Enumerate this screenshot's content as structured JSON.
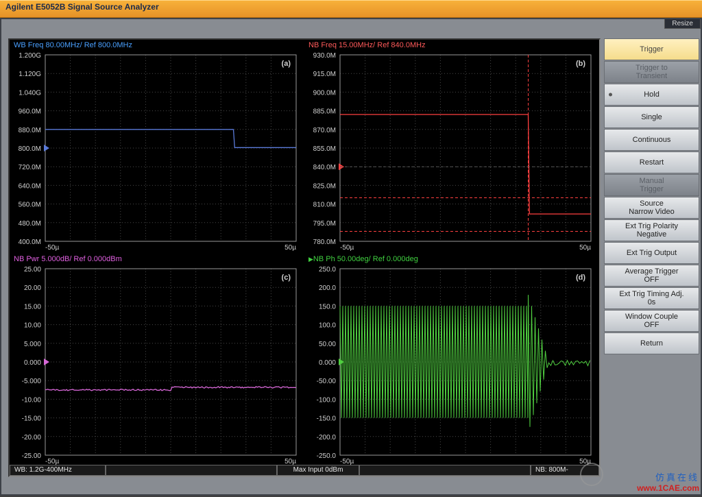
{
  "title": "Agilent E5052B Signal Source Analyzer",
  "resize": "Resize",
  "side_panel": [
    {
      "label": "Trigger",
      "state": "active"
    },
    {
      "label": "Trigger to\nTransient",
      "state": "disabled"
    },
    {
      "label": "Hold",
      "state": "normal",
      "dot": true
    },
    {
      "label": "Single",
      "state": "normal"
    },
    {
      "label": "Continuous",
      "state": "normal"
    },
    {
      "label": "Restart",
      "state": "normal"
    },
    {
      "label": "Manual\nTrigger",
      "state": "disabled"
    },
    {
      "label": "Source\nNarrow Video",
      "state": "normal"
    },
    {
      "label": "Ext Trig Polarity\nNegative",
      "state": "normal"
    },
    {
      "label": "Ext Trig Output",
      "state": "normal"
    },
    {
      "label": "Average Trigger\nOFF",
      "state": "normal"
    },
    {
      "label": "Ext Trig Timing Adj.\n0s",
      "state": "normal"
    },
    {
      "label": "Window Couple\nOFF",
      "state": "normal"
    },
    {
      "label": "Return",
      "state": "normal"
    }
  ],
  "status": {
    "wb": "WB: 1.2G-400MHz",
    "max_input": "Max Input 0dBm",
    "nb": "NB: 800M-"
  },
  "watermark": {
    "cn": "仿真在线",
    "url": "www.1CAE.com"
  },
  "chart_data": [
    {
      "id": "a",
      "type": "line",
      "title": "WB Freq 80.00MHz/ Ref 800.0MHz",
      "color": "#5a7ad8",
      "corner": "(a)",
      "xlabel_left": "-50µ",
      "xlabel_right": "50µ",
      "ref_label": "800.0M",
      "ref_value": 800.0,
      "yticks": [
        "1.200G",
        "1.120G",
        "1.040G",
        "960.0M",
        "880.0M",
        "800.0M",
        "720.0M",
        "640.0M",
        "560.0M",
        "480.0M",
        "400.0M"
      ],
      "ylim": [
        400,
        1200
      ],
      "xrange": [
        -50,
        50
      ],
      "data_x": [
        -50,
        25,
        25,
        50
      ],
      "data_y": [
        880,
        880,
        802,
        802
      ]
    },
    {
      "id": "b",
      "type": "line",
      "title": "NB Freq 15.00MHz/ Ref 840.0MHz",
      "color": "#ff4040",
      "corner": "(b)",
      "xlabel_left": "-50µ",
      "xlabel_right": "50µ",
      "ref_label": "840.0M",
      "ref_value": 840.0,
      "yticks": [
        "930.0M",
        "915.0M",
        "900.0M",
        "885.0M",
        "870.0M",
        "855.0M",
        "840.0M",
        "825.0M",
        "810.0M",
        "795.0M",
        "780.0M"
      ],
      "ylim": [
        780,
        930
      ],
      "xrange": [
        -50,
        50
      ],
      "data_x": [
        -50,
        25,
        25,
        50
      ],
      "data_y": [
        882,
        882,
        802,
        802
      ],
      "extra_dash_y": [
        815,
        788
      ],
      "extra_dash_x": 25
    },
    {
      "id": "c",
      "type": "line",
      "title": "NB Pwr 5.000dB/ Ref 0.000dBm",
      "color": "#d868d8",
      "corner": "(c)",
      "xlabel_left": "-50µ",
      "xlabel_right": "50µ",
      "ref_label": "0.000",
      "ref_value": 0.0,
      "yticks": [
        "25.00",
        "20.00",
        "15.00",
        "10.00",
        "5.000",
        "0.000",
        "-5.000",
        "-10.00",
        "-15.00",
        "-20.00",
        "-25.00"
      ],
      "ylim": [
        -25,
        25
      ],
      "xrange": [
        -50,
        50
      ],
      "data_x": [
        -50,
        0,
        0,
        50
      ],
      "data_y": [
        -7.5,
        -7.5,
        -6.8,
        -6.8
      ],
      "noise": 0.4
    },
    {
      "id": "d",
      "type": "line",
      "title": "NB Ph 50.00deg/ Ref 0.000deg",
      "color": "#50d040",
      "corner": "(d)",
      "xlabel_left": "-50µ",
      "xlabel_right": "50µ",
      "ref_label": "0.000",
      "ref_value": 0.0,
      "yticks": [
        "250.0",
        "200.0",
        "150.0",
        "100.0",
        "50.00",
        "0.000",
        "-50.00",
        "-100.0",
        "-150.0",
        "-200.0",
        "-250.0"
      ],
      "ylim": [
        -250,
        250
      ],
      "xrange": [
        -50,
        50
      ],
      "phase_env_before": [
        150,
        -150
      ],
      "phase_break_x": 25,
      "phase_spike": [
        180,
        -190
      ],
      "phase_settle": [
        -10,
        5
      ]
    }
  ]
}
